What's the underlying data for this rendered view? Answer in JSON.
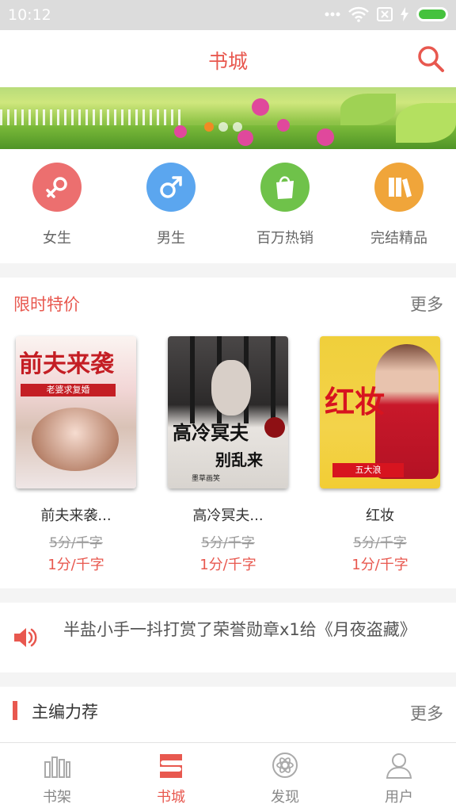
{
  "status_bar": {
    "time": "10:12"
  },
  "header": {
    "title": "书城"
  },
  "banner": {
    "dot_count": 3,
    "active_dot": 0
  },
  "categories": [
    {
      "label": "女生",
      "icon": "female-icon",
      "color": "#ec6f6f"
    },
    {
      "label": "男生",
      "icon": "male-icon",
      "color": "#5ba6ef"
    },
    {
      "label": "百万热销",
      "icon": "shopping-bag-icon",
      "color": "#6fc24a"
    },
    {
      "label": "完结精品",
      "icon": "books-icon",
      "color": "#f0a53a"
    }
  ],
  "sale_section": {
    "title": "限时特价",
    "more_label": "更多",
    "books": [
      {
        "title": "前夫来袭...",
        "old_price": "5分/千字",
        "new_price": "1分/千字",
        "cover_title": "前夫来袭",
        "cover_subtitle": "老婆求复婚"
      },
      {
        "title": "高冷冥夫...",
        "old_price": "5分/千字",
        "new_price": "1分/千字",
        "cover_title": "高冷冥夫",
        "cover_subtitle": "别乱来",
        "cover_author": "墨草画笑"
      },
      {
        "title": "红妆",
        "old_price": "5分/千字",
        "new_price": "1分/千字",
        "cover_title": "红妆",
        "cover_author": "五大浪"
      }
    ]
  },
  "notice": {
    "text": "半盐小手一抖打赏了荣誉勋章x1给《月夜盗藏》"
  },
  "editor_section": {
    "title": "主编力荐",
    "more_label": "更多"
  },
  "tabs": [
    {
      "label": "书架",
      "icon": "bookshelf-icon",
      "active": false
    },
    {
      "label": "书城",
      "icon": "bookstore-icon",
      "active": true
    },
    {
      "label": "发现",
      "icon": "discover-icon",
      "active": false
    },
    {
      "label": "用户",
      "icon": "user-icon",
      "active": false
    }
  ],
  "colors": {
    "accent": "#e8584f",
    "text_secondary": "#777777"
  }
}
